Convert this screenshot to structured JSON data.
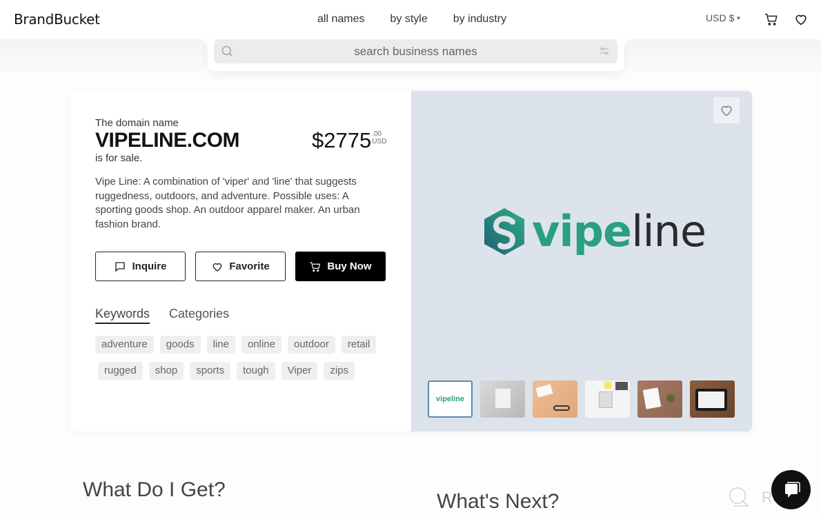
{
  "header": {
    "logo": "BrandBucket",
    "nav": [
      "all names",
      "by style",
      "by industry"
    ],
    "currency": "USD $",
    "currency_caret": "▾"
  },
  "search": {
    "placeholder": "search business names",
    "value": ""
  },
  "listing": {
    "pre_title": "The domain name",
    "domain": "VIPELINE.COM",
    "post_title": "is for sale.",
    "price": "$2775",
    "price_cents": ".00",
    "price_currency": "USD",
    "description": "Vipe Line: A combination of 'viper' and 'line' that suggests ruggedness, outdoors, and adventure. Possible uses: A sporting goods shop. An outdoor apparel maker. An urban fashion brand.",
    "buttons": {
      "inquire": "Inquire",
      "favorite": "Favorite",
      "buy": "Buy Now"
    },
    "tabs": [
      {
        "label": "Keywords",
        "active": true
      },
      {
        "label": "Categories",
        "active": false
      }
    ],
    "keywords_row1": [
      "adventure",
      "goods",
      "line",
      "online",
      "outdoor",
      "retail"
    ],
    "keywords_row2": [
      "rugged",
      "shop",
      "sports",
      "tough",
      "Viper",
      "zips"
    ]
  },
  "preview": {
    "logo_part1": "vipe",
    "logo_part2": "line",
    "thumb_logo": "vipeline",
    "thumbnails": [
      "logo",
      "phone-desk-gray",
      "glasses-pen-orange",
      "notebook-desk-white",
      "paper-coffee-wood",
      "tablet-wood"
    ],
    "colors": {
      "teal": "#2a9f82",
      "dark": "#2a2a2e",
      "bg": "#dde3ea"
    }
  },
  "sections": {
    "what_do_i_get": "What Do I Get?",
    "whats_next": "What's Next?"
  },
  "watermark": "Revain"
}
